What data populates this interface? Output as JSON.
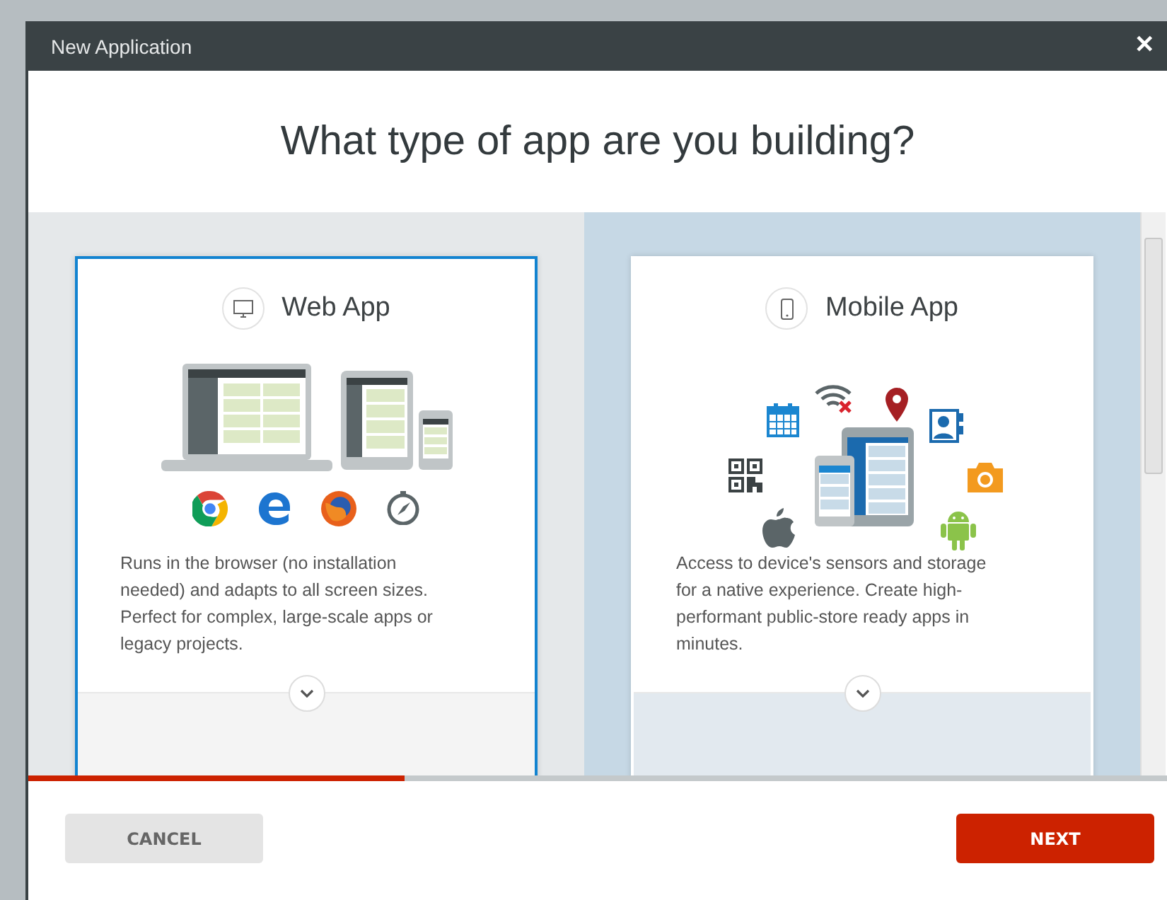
{
  "window": {
    "title": "New Application",
    "close": "✕"
  },
  "heading": "What type of app are you building?",
  "options": [
    {
      "kind": "web",
      "title": "Web App",
      "selected": true,
      "highlighted": false,
      "description": "Runs in the browser (no installation needed) and adapts to all screen sizes. Perfect for complex, large-scale apps or legacy projects."
    },
    {
      "kind": "mobile",
      "title": "Mobile App",
      "selected": false,
      "highlighted": true,
      "description": "Access to device's sensors and storage for a native experience. Create high-performant public-store ready apps in minutes."
    }
  ],
  "progress": {
    "level": 0.33
  },
  "buttons": [
    {
      "kind": "secondary",
      "label": "CANCEL"
    },
    {
      "kind": "primary",
      "label": "NEXT"
    }
  ]
}
